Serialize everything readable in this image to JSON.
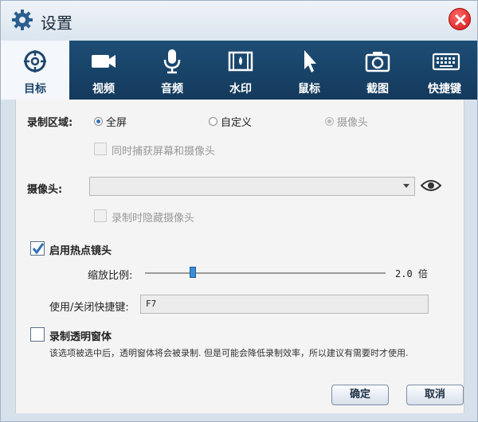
{
  "window": {
    "title": "设置"
  },
  "icons": {
    "title": "gear-icon",
    "close": "close-icon",
    "camera_preview": "eye-icon"
  },
  "tabs": [
    {
      "label": "目标",
      "icon": "target-icon",
      "active": true
    },
    {
      "label": "视频",
      "icon": "video-camera-icon"
    },
    {
      "label": "音频",
      "icon": "microphone-icon"
    },
    {
      "label": "水印",
      "icon": "watermark-film-icon"
    },
    {
      "label": "鼠标",
      "icon": "cursor-icon"
    },
    {
      "label": "截图",
      "icon": "camera-icon"
    },
    {
      "label": "快捷键",
      "icon": "keyboard-icon"
    }
  ],
  "record_area": {
    "label": "录制区域:",
    "options": [
      {
        "label": "全屏",
        "checked": true
      },
      {
        "label": "自定义",
        "checked": false
      },
      {
        "label": "摄像头",
        "checked": true,
        "disabled": true
      }
    ],
    "capture_both_label": "同时捕获屏幕和摄像头"
  },
  "camera": {
    "label": "摄像头:",
    "selected": "",
    "hide_when_recording_label": "录制时隐藏摄像头"
  },
  "hotspot": {
    "label": "启用热点镜头",
    "checked": true,
    "zoom_label": "缩放比例:",
    "zoom_value": "2.0 倍",
    "zoom_level": 0.2,
    "shortcut_label": "使用/关闭快捷键:",
    "shortcut_value": "F7"
  },
  "transparent": {
    "label": "录制透明窗体",
    "checked": false,
    "note": "该选项被选中后，透明窗体将会被录制. 但是可能会降低录制效率，所以建议有需要时才使用."
  },
  "buttons": {
    "ok": "确定",
    "cancel": "取消"
  },
  "colors": {
    "tab_bar": "#1d4d75",
    "accent": "#3b8fd6",
    "close": "#d31414"
  }
}
